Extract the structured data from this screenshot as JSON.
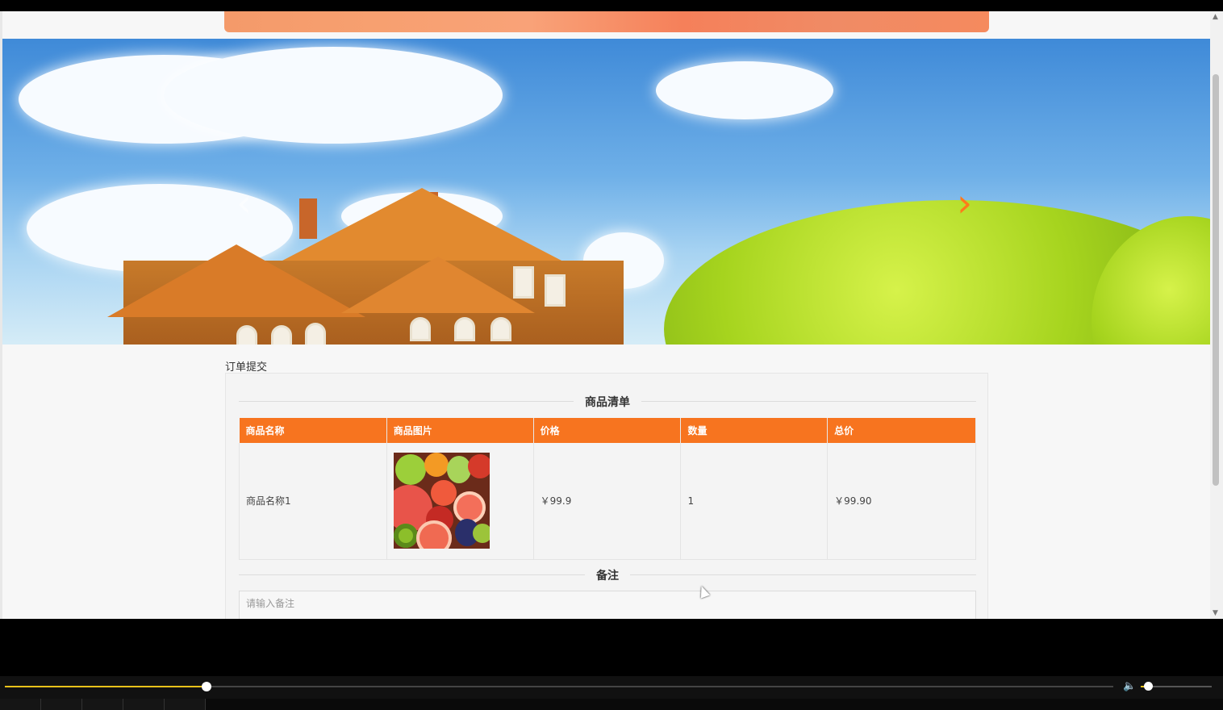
{
  "order": {
    "section_title": "订单提交",
    "goods_list_title": "商品清单",
    "table": {
      "headers": [
        "商品名称",
        "商品图片",
        "价格",
        "数量",
        "总价"
      ],
      "rows": [
        {
          "name": "商品名称1",
          "price": "￥99.9",
          "quantity": "1",
          "total": "￥99.90"
        }
      ]
    },
    "remark_title": "备注",
    "remark_placeholder": "请输入备注"
  },
  "carousel": {
    "prev_icon": "chevron-left-icon",
    "next_icon": "chevron-right-icon",
    "prev_glyph": "‹",
    "next_glyph": "›"
  },
  "player": {
    "progress_fraction": 0.182,
    "volume_fraction": 0.1,
    "volume_icon": "volume-icon",
    "volume_glyph": "🔈"
  },
  "colors": {
    "accent": "#f7741f",
    "progress": "#e8c21a"
  }
}
